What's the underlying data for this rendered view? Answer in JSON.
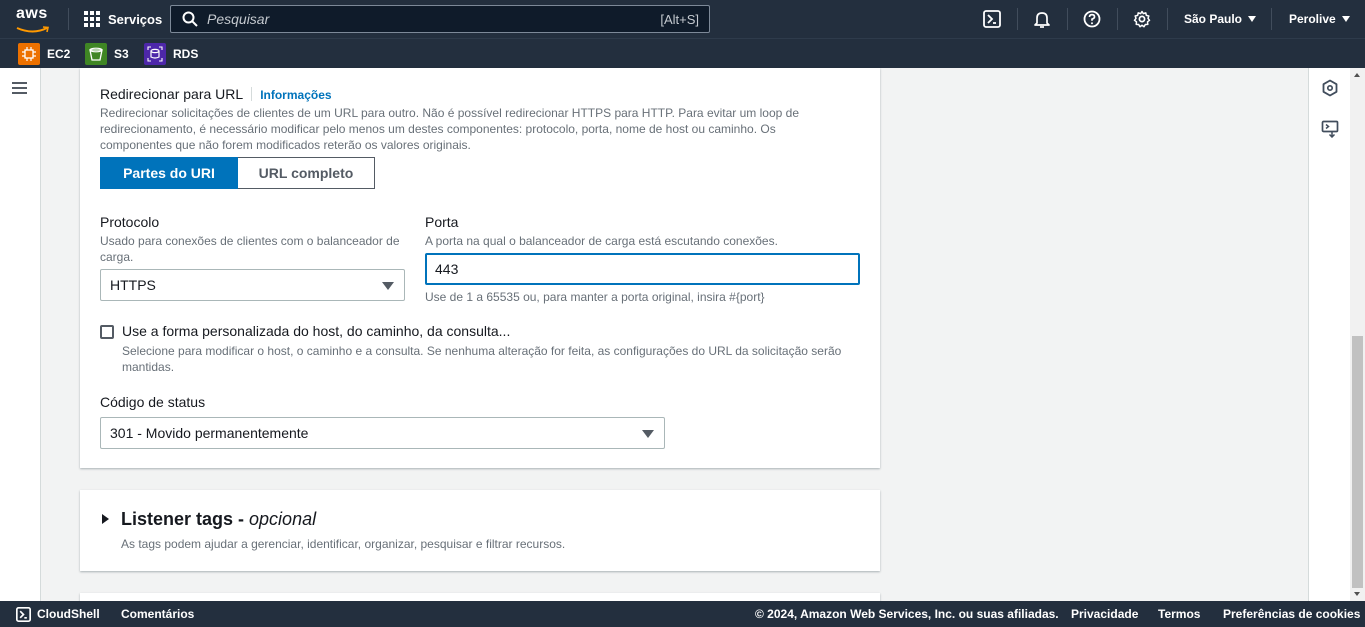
{
  "nav": {
    "logo_text": "aws",
    "services_label": "Serviços",
    "search_placeholder": "Pesquisar",
    "search_shortcut": "[Alt+S]",
    "region_label": "São Paulo",
    "user_label": "Perolive"
  },
  "favorites": [
    {
      "label": "EC2",
      "color": "#ed7100"
    },
    {
      "label": "S3",
      "color": "#3f8624"
    },
    {
      "label": "RDS",
      "color": "#4d27aa"
    }
  ],
  "redirect": {
    "title": "Redirecionar para URL",
    "info_link": "Informações",
    "description": "Redirecionar solicitações de clientes de um URL para outro. Não é possível redirecionar HTTPS para HTTP. Para evitar um loop de redirecionamento, é necessário modificar pelo menos um destes componentes: protocolo, porta, nome de host ou caminho. Os componentes que não forem modificados reterão os valores originais.",
    "seg_active": "Partes do URI",
    "seg_inactive": "URL completo"
  },
  "protocol": {
    "label": "Protocolo",
    "description": "Usado para conexões de clientes com o balanceador de carga.",
    "value": "HTTPS"
  },
  "port": {
    "label": "Porta",
    "description": "A porta na qual o balanceador de carga está escutando conexões.",
    "value": "443",
    "hint": "Use de 1 a 65535 ou, para manter a porta original, insira #{port}"
  },
  "custom": {
    "label": "Use a forma personalizada do host, do caminho, da consulta...",
    "description": "Selecione para modificar o host, o caminho e a consulta. Se nenhuma alteração for feita, as configurações do URL da solicitação serão mantidas."
  },
  "status": {
    "label": "Código de status",
    "value": "301 - Movido permanentemente"
  },
  "tags": {
    "title": "Listener tags - ",
    "title_optional": "opcional",
    "description": "As tags podem ajudar a gerenciar, identificar, organizar, pesquisar e filtrar recursos."
  },
  "footer": {
    "cloudshell": "CloudShell",
    "feedback": "Comentários",
    "copyright": "© 2024, Amazon Web Services, Inc. ou suas afiliadas.",
    "privacy": "Privacidade",
    "terms": "Termos",
    "cookies": "Preferências de cookies"
  },
  "colors": {
    "nav_bg": "#232f3e",
    "accent": "#0073bb"
  }
}
